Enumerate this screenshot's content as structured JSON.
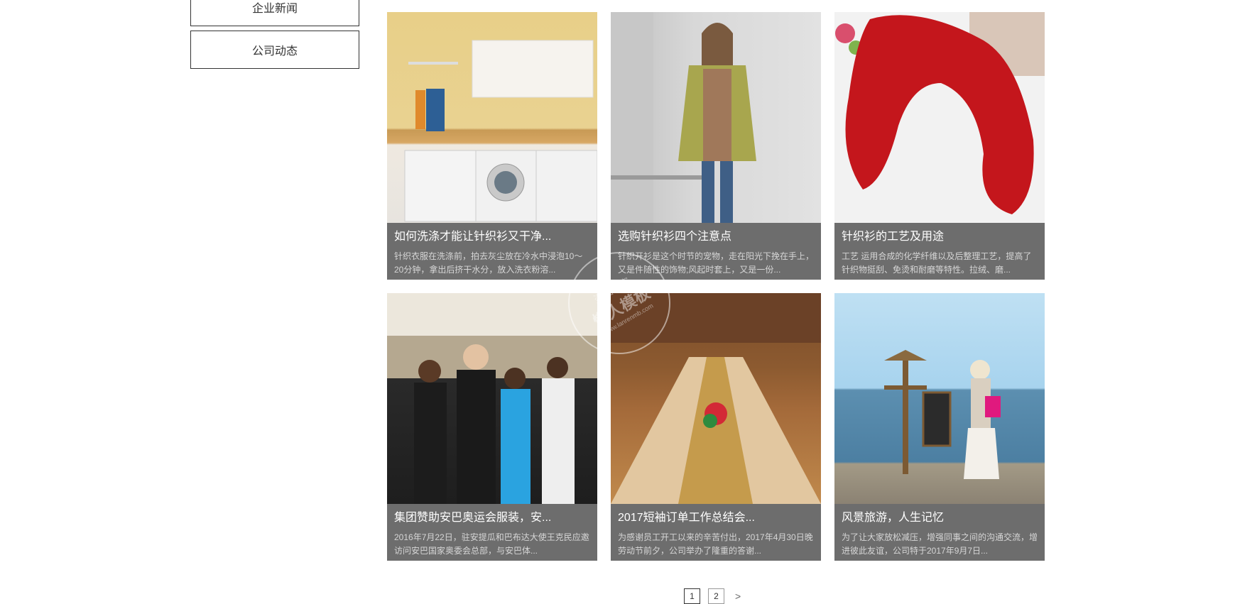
{
  "sidebar": {
    "items": [
      {
        "label": "企业新闻"
      },
      {
        "label": "公司动态"
      }
    ]
  },
  "cards": [
    {
      "title": "如何洗涤才能让针织衫又干净...",
      "desc": "针织衣服在洗涤前，拍去灰尘放在冷水中浸泡10～20分钟，拿出后挤干水分，放入洗衣粉溶...",
      "image": "laundry-room"
    },
    {
      "title": "选购针织衫四个注意点",
      "desc": "针织开衫是这个时节的宠物，走在阳光下挽在手上，又是件随性的饰物;风起时套上，又是一份...",
      "image": "woman-green-cardigan"
    },
    {
      "title": "针织衫的工艺及用途",
      "desc": "工艺 运用合成的化学纤维以及后整理工艺，提高了针织物挺刮、免烫和耐磨等特性。拉绒、磨...",
      "image": "red-knit-scarf"
    },
    {
      "title": "集团赞助安巴奥运会服装，安...",
      "desc": "2016年7月22日，驻安提瓜和巴布达大使王克民应邀访问安巴国家奥委会总部，与安巴体...",
      "image": "group-photo"
    },
    {
      "title": "2017短袖订单工作总结会...",
      "desc": "为感谢员工开工以来的辛苦付出，2017年4月30日晚劳动节前夕，公司举办了隆重的答谢...",
      "image": "banquet-hall"
    },
    {
      "title": "风景旅游，人生记忆",
      "desc": "为了让大家放松减压，增强同事之间的沟通交流，增进彼此友谊，公司特于2017年9月7日...",
      "image": "seaside-travel"
    }
  ],
  "pagination": {
    "pages": [
      "1",
      "2"
    ],
    "current": "1",
    "next_label": ">"
  },
  "watermark": {
    "line1": "盗图必究",
    "line2": "懒人模板",
    "url": "www.lanrenmb.com"
  }
}
